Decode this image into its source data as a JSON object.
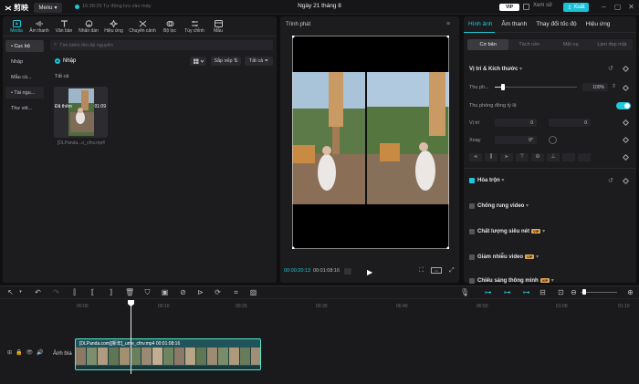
{
  "titlebar": {
    "app_logo": "剪映",
    "menu_label": "Menu",
    "autosave_text": "16:38:29 Tự động lưu vào máy",
    "project_title": "Ngày 21 tháng 8",
    "vip_label": "VIP",
    "shortcut_label": "Xem sử",
    "export_label": "Xuất"
  },
  "toolbar": {
    "items": [
      {
        "label": "Media",
        "icon": "media-icon",
        "active": true
      },
      {
        "label": "Âm thanh",
        "icon": "audio-icon"
      },
      {
        "label": "Văn bản",
        "icon": "text-icon"
      },
      {
        "label": "Nhãn dán",
        "icon": "sticker-icon"
      },
      {
        "label": "Hiệu ứng",
        "icon": "effects-icon"
      },
      {
        "label": "Chuyển cảnh",
        "icon": "transition-icon"
      },
      {
        "label": "Bộ lọc",
        "icon": "filter-icon"
      },
      {
        "label": "Tùy chỉnh",
        "icon": "adjust-icon"
      },
      {
        "label": "Mẫu",
        "icon": "template-icon"
      }
    ]
  },
  "sidebar": {
    "items": [
      {
        "label": "• Cục bộ"
      },
      {
        "label": "Nhập"
      },
      {
        "label": "Mẫu cù..."
      },
      {
        "label": "• Tài ngu..."
      },
      {
        "label": "Thư viê..."
      }
    ]
  },
  "media": {
    "search_placeholder": "Tìm kiếm tên tài nguyên",
    "import_label": "Nhập",
    "sort_label": "Sắp xếp",
    "filter_label": "Tất cả",
    "all_label": "Tất cả",
    "item": {
      "added_text": "Đã thêm",
      "duration": "01:09",
      "filename": "[DLPanda...o_cfnv.mp4"
    }
  },
  "player": {
    "title": "Trình phát",
    "current_time": "00:00:20:13",
    "total_time": "00:01:08:16"
  },
  "inspector": {
    "tabs": [
      {
        "label": "Hình ảnh",
        "active": true
      },
      {
        "label": "Âm thanh"
      },
      {
        "label": "Thay đổi tốc độ"
      },
      {
        "label": "Hiệu ứng"
      }
    ],
    "subtabs": [
      {
        "label": "Cơ bản",
        "active": true
      },
      {
        "label": "Tách nền"
      },
      {
        "label": "Mặt nạ"
      },
      {
        "label": "Làm đẹp mặt"
      }
    ],
    "position_size_header": "Vị trí & Kích thước",
    "scale_label": "Thu ph...",
    "scale_value": "100%",
    "scale_fraction": 0.1,
    "uniform_scale_label": "Thu phóng đồng tỷ lệ",
    "position_label": "Vị trí",
    "pos_x_prefix": "X",
    "pos_x": "0",
    "pos_y_prefix": "Y",
    "pos_y": "0",
    "rotate_label": "Xoay",
    "rotate_value": "0°",
    "blend_label": "Hòa trộn",
    "stabilize_label": "Chống rung video",
    "hdr_label": "Chất lượng siêu nét",
    "denoise_label": "Giảm nhiễu video",
    "light_label": "Chiếu sáng thông minh",
    "vip_tag": "VIP"
  },
  "timeline": {
    "ruler": [
      "00:00",
      "00:10",
      "00:20",
      "00:30",
      "00:40",
      "00:50",
      "01:00",
      "01:10"
    ],
    "clip_label": "[DLPanda.com][新年]_ume_cfnv.mp4  00:01:08:16",
    "track_label": "Ảnh bìa"
  },
  "colors": {
    "accent": "#1ec8d8",
    "clip_border": "#50e5c8",
    "panel": "#1c1c1f"
  }
}
